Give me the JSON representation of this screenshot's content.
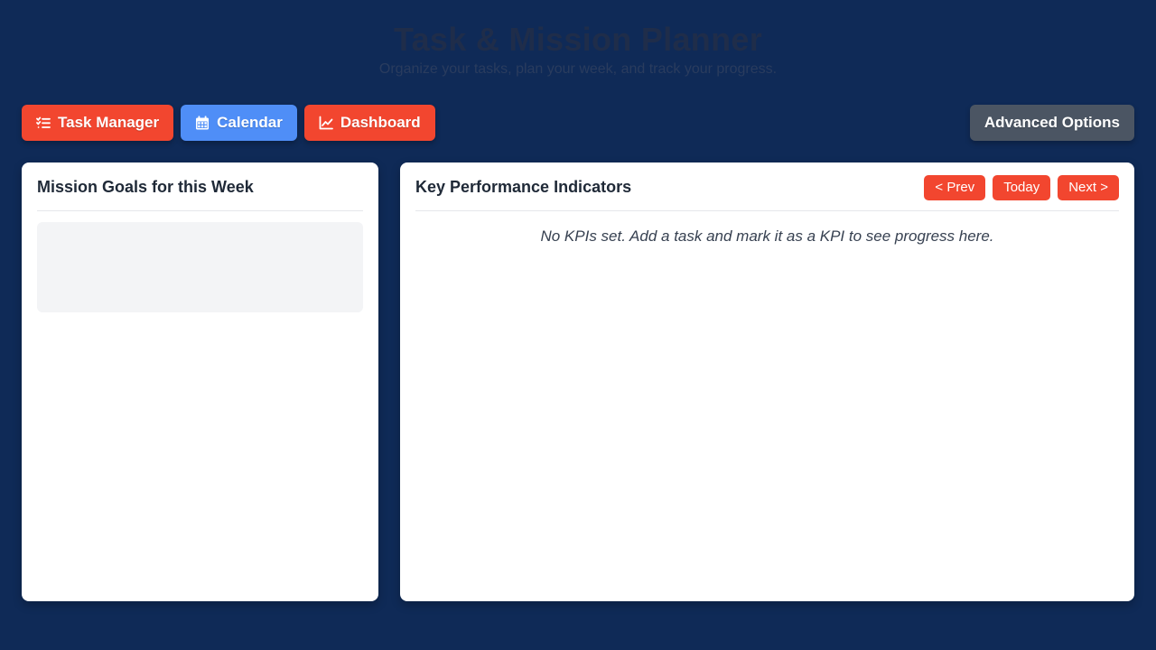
{
  "header": {
    "title": "Task & Mission Planner",
    "subtitle": "Organize your tasks, plan your week, and track your progress."
  },
  "toolbar": {
    "task_manager": {
      "label": "Task Manager",
      "icon": "list-check-icon",
      "color": "#f2462f"
    },
    "calendar": {
      "label": "Calendar",
      "icon": "calendar-icon",
      "color": "#4f8ef7"
    },
    "dashboard": {
      "label": "Dashboard",
      "icon": "chart-line-icon",
      "color": "#f2462f"
    },
    "advanced": {
      "label": "Advanced Options",
      "color": "#4b5563"
    }
  },
  "goals_panel": {
    "title": "Mission Goals for this Week"
  },
  "kpi_panel": {
    "title": "Key Performance Indicators",
    "prev_label": "< Prev",
    "today_label": "Today",
    "next_label": "Next >",
    "empty_message": "No KPIs set. Add a task and mark it as a KPI to see progress here."
  },
  "colors": {
    "background": "#0f2a57",
    "accent_red": "#f2462f",
    "accent_blue": "#4f8ef7",
    "neutral_gray": "#4b5563"
  }
}
